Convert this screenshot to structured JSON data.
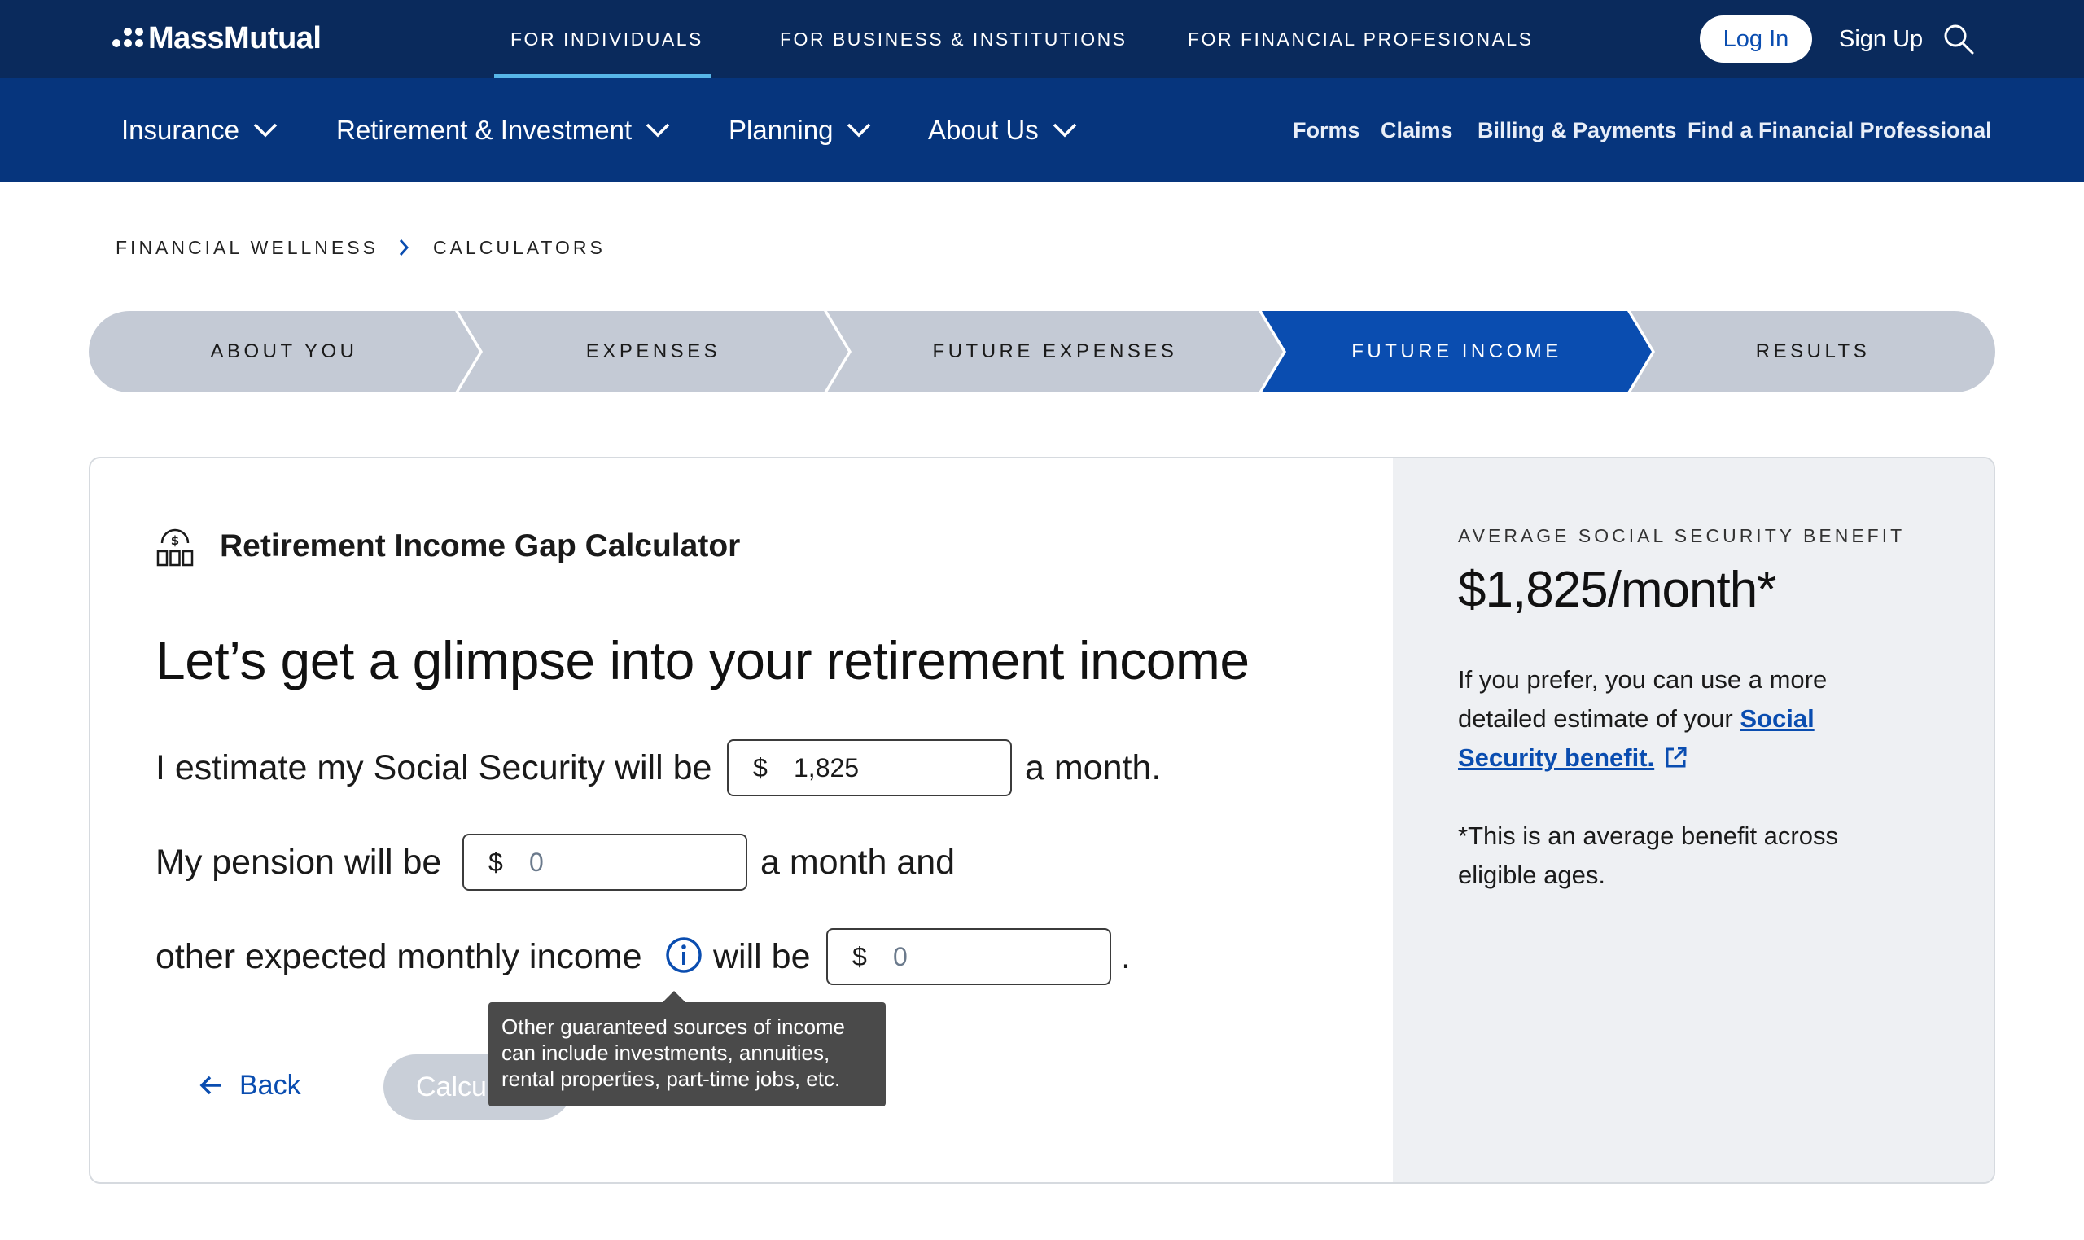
{
  "header": {
    "brand": "MassMutual",
    "audiences": [
      "FOR INDIVIDUALS",
      "FOR BUSINESS & INSTITUTIONS",
      "FOR FINANCIAL PROFESIONALS"
    ],
    "login_label": "Log In",
    "signup_label": "Sign Up",
    "search_icon": "search-icon"
  },
  "nav": {
    "items": [
      "Insurance",
      "Retirement & Investment",
      "Planning",
      "About Us"
    ],
    "utility": [
      "Forms",
      "Claims",
      "Billing & Payments",
      "Find a Financial Professional"
    ]
  },
  "breadcrumb": [
    "FINANCIAL WELLNESS",
    "CALCULATORS"
  ],
  "stepper": {
    "steps": [
      "ABOUT YOU",
      "EXPENSES",
      "FUTURE EXPENSES",
      "FUTURE INCOME",
      "RESULTS"
    ],
    "active_index": 3
  },
  "calculator": {
    "title": "Retirement Income Gap Calculator",
    "headline": "Let’s get a glimpse into your retirement income",
    "ss_prefix": "I estimate my Social Security will be",
    "ss_suffix": "a month.",
    "pension_prefix": "My pension will be",
    "pension_suffix": "a month and",
    "other_prefix": "other expected monthly income",
    "other_middle": "will be",
    "other_suffix": ".",
    "currency": "$",
    "ss_value": "1,825",
    "pension_placeholder": "0",
    "other_placeholder": "0",
    "tooltip": "Other guaranteed sources of income can include investments, annuities, rental properties, part-time jobs, etc.",
    "back_label": "Back",
    "calculate_label": "Calcu"
  },
  "sidebar": {
    "label": "AVERAGE SOCIAL SECURITY BENEFIT",
    "value": "$1,825/month*",
    "text_before_link": "If you prefer, you can use a more detailed estimate of your",
    "link_text": "Social Security benefit.",
    "note": "*This is an average benefit across eligible ages."
  },
  "colors": {
    "top_bar": "#0a2a5c",
    "main_nav": "#06357d",
    "accent": "#0a4db0",
    "active_step": "#0a4db0",
    "inactive_step": "#c4cad5"
  }
}
